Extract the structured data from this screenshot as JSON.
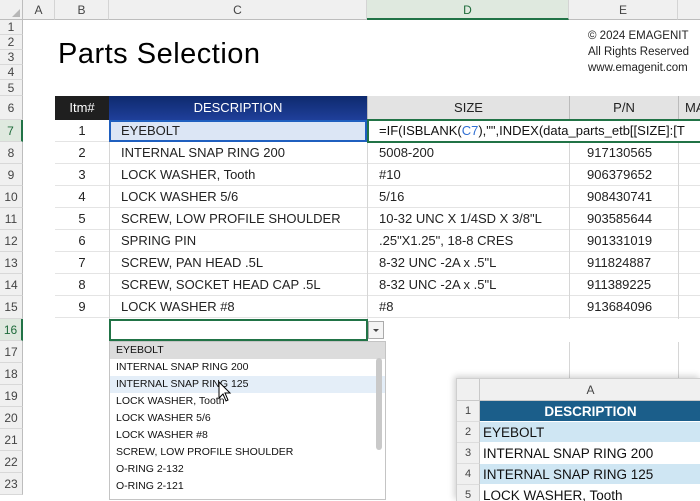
{
  "columns": [
    "A",
    "B",
    "C",
    "D",
    "E"
  ],
  "rows": [
    "1",
    "2",
    "3",
    "4",
    "5",
    "6",
    "7",
    "8",
    "9",
    "10",
    "11",
    "12",
    "13",
    "14",
    "15",
    "16",
    "17",
    "18",
    "19",
    "20",
    "21",
    "22",
    "23"
  ],
  "title": "Parts Selection",
  "copyright": [
    "© 2024 EMAGENIT",
    "All Rights Reserved",
    "www.emagenit.com"
  ],
  "table": {
    "headers": {
      "item": "Itm#",
      "description": "DESCRIPTION",
      "size": "SIZE",
      "pn": "P/N",
      "more": "MA"
    },
    "rows": [
      {
        "n": "1",
        "desc": "EYEBOLT",
        "size": "",
        "pn": ""
      },
      {
        "n": "2",
        "desc": "INTERNAL SNAP RING 200",
        "size": "5008-200",
        "pn": "917130565"
      },
      {
        "n": "3",
        "desc": "LOCK WASHER, Tooth",
        "size": "#10",
        "pn": "906379652"
      },
      {
        "n": "4",
        "desc": "LOCK WASHER 5/6",
        "size": "5/16",
        "pn": "908430741"
      },
      {
        "n": "5",
        "desc": "SCREW, LOW PROFILE SHOULDER",
        "size": "10-32 UNC X 1/4SD X 3/8\"L",
        "pn": "903585644"
      },
      {
        "n": "6",
        "desc": "SPRING PIN",
        "size": ".25\"X1.25\", 18-8 CRES",
        "pn": "901331019"
      },
      {
        "n": "7",
        "desc": "SCREW, PAN HEAD .5L",
        "size": "8-32 UNC -2A x .5\"L",
        "pn": "911824887"
      },
      {
        "n": "8",
        "desc": "SCREW, SOCKET HEAD CAP .5L",
        "size": "8-32 UNC -2A x .5\"L",
        "pn": "911389225"
      },
      {
        "n": "9",
        "desc": "LOCK WASHER #8",
        "size": "#8",
        "pn": "913684096"
      }
    ]
  },
  "formula": {
    "part1": "=IF(ISBLANK(",
    "ref": "C7",
    "part2": "),\"\",INDEX(data_parts_etb[[SIZE]:[T"
  },
  "dropdown": {
    "items": [
      "EYEBOLT",
      "INTERNAL SNAP RING 200",
      "INTERNAL SNAP RING 125",
      "LOCK WASHER, Tooth",
      "LOCK WASHER 5/6",
      "LOCK WASHER #8",
      "SCREW, LOW PROFILE SHOULDER",
      "O-RING 2-132",
      "O-RING 2-121"
    ]
  },
  "mini_sheet": {
    "col": "A",
    "header": "DESCRIPTION",
    "row_numbers": [
      "1",
      "2",
      "3",
      "4",
      "5"
    ],
    "rows": [
      "EYEBOLT",
      "INTERNAL SNAP RING 200",
      "INTERNAL SNAP RING 125",
      "LOCK WASHER, Tooth"
    ]
  },
  "colors": {
    "accent": "#217346",
    "header_blue": "#1f3f9a",
    "selected_cell": "#dce6f5",
    "formula_ref": "#2f6fd3"
  }
}
